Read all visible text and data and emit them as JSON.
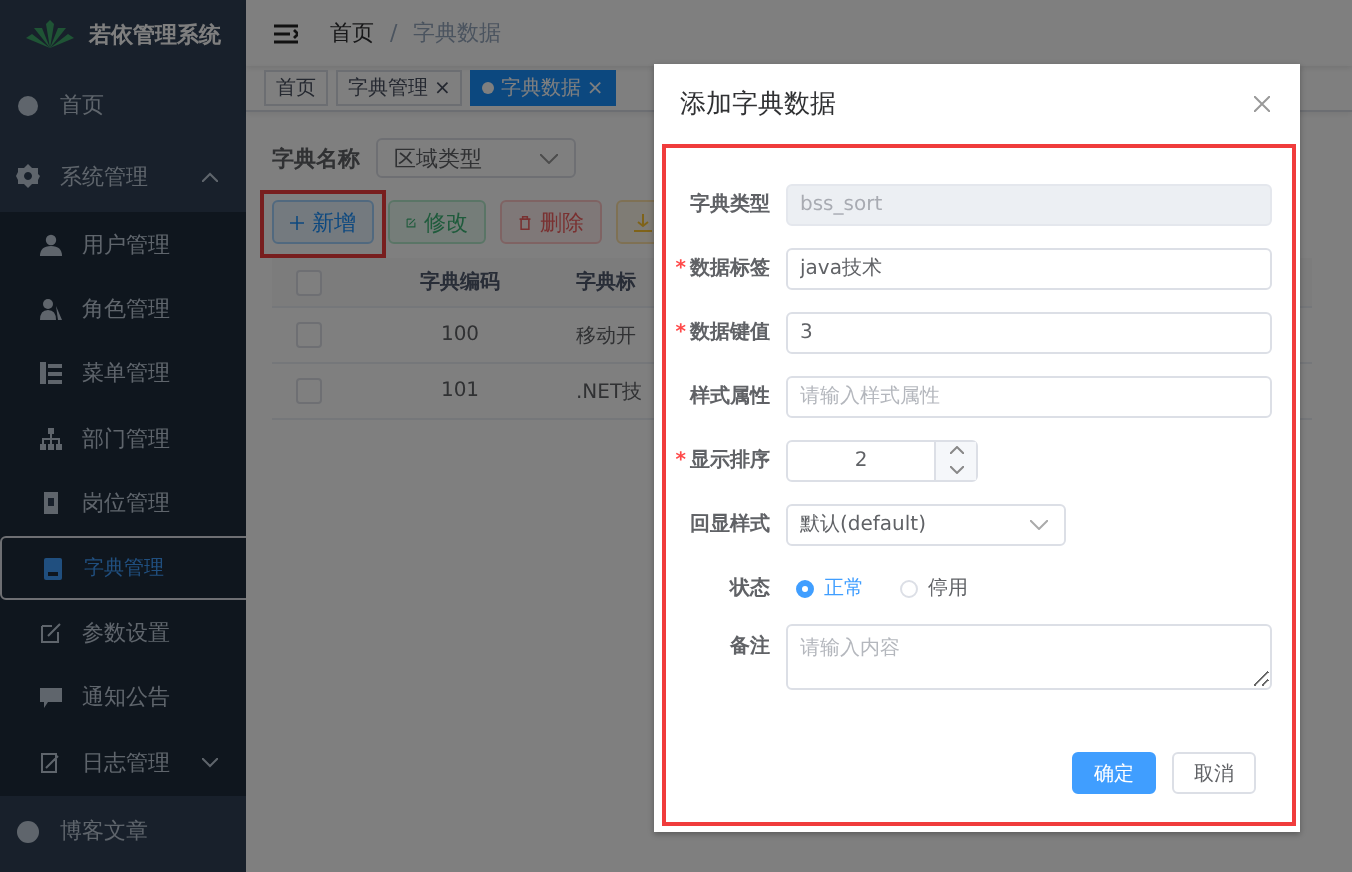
{
  "sidebar": {
    "logo_title": "若依管理系统",
    "items": [
      {
        "label": "首页",
        "selected": false
      },
      {
        "label": "系统管理",
        "selected": false,
        "expanded": true,
        "children": [
          {
            "label": "用户管理",
            "selected": false
          },
          {
            "label": "角色管理",
            "selected": false
          },
          {
            "label": "菜单管理",
            "selected": false
          },
          {
            "label": "部门管理",
            "selected": false
          },
          {
            "label": "岗位管理",
            "selected": false
          },
          {
            "label": "字典管理",
            "selected": true
          },
          {
            "label": "参数设置",
            "selected": false
          },
          {
            "label": "通知公告",
            "selected": false
          },
          {
            "label": "日志管理",
            "selected": false,
            "expanded": false
          }
        ]
      },
      {
        "label": "博客文章",
        "selected": false
      }
    ]
  },
  "breadcrumb": {
    "separator": "/",
    "items": [
      "首页",
      "字典数据"
    ]
  },
  "tags": [
    {
      "label": "首页",
      "selected": false
    },
    {
      "label": "字典管理",
      "selected": false,
      "close": "×"
    },
    {
      "label": "字典数据",
      "selected": true,
      "close": "×"
    }
  ],
  "filter": {
    "label": "字典名称",
    "value": "区域类型"
  },
  "toolbar": [
    {
      "kind": "primary",
      "label": "新增",
      "disabled": false
    },
    {
      "kind": "success",
      "label": "修改",
      "disabled": true
    },
    {
      "kind": "danger",
      "label": "删除",
      "disabled": true
    },
    {
      "kind": "warning",
      "disabled": true
    }
  ],
  "table": {
    "all_checked": false,
    "columns": [
      "字典编码",
      "字典标"
    ],
    "rows": [
      {
        "checked": false,
        "cells": [
          "100",
          "移动开"
        ]
      },
      {
        "checked": false,
        "cells": [
          "101",
          ".NET技"
        ]
      }
    ]
  },
  "dialog": {
    "title": "添加字典数据",
    "fields": [
      {
        "kind": "input",
        "label": "字典类型",
        "disabled": true,
        "value": "bss_sort"
      },
      {
        "kind": "input",
        "label": "数据标签",
        "required_mark": "*",
        "disabled": false,
        "value": "java技术"
      },
      {
        "kind": "input",
        "label": "数据键值",
        "required_mark": "*",
        "disabled": false,
        "value": "3"
      },
      {
        "kind": "input",
        "label": "样式属性",
        "disabled": false,
        "placeholder": "请输入样式属性"
      },
      {
        "kind": "number",
        "label": "显示排序",
        "required_mark": "*",
        "value": "2"
      },
      {
        "kind": "select",
        "label": "回显样式",
        "value": "默认(default)"
      },
      {
        "kind": "radio",
        "label": "状态",
        "options": [
          {
            "label": "正常",
            "selected": true
          },
          {
            "label": "停用",
            "selected": false
          }
        ]
      },
      {
        "kind": "textarea",
        "label": "备注",
        "placeholder": "请输入内容"
      }
    ],
    "buttons": [
      {
        "kind": "primary",
        "label": "确定"
      },
      {
        "kind": "default",
        "label": "取消"
      }
    ]
  }
}
